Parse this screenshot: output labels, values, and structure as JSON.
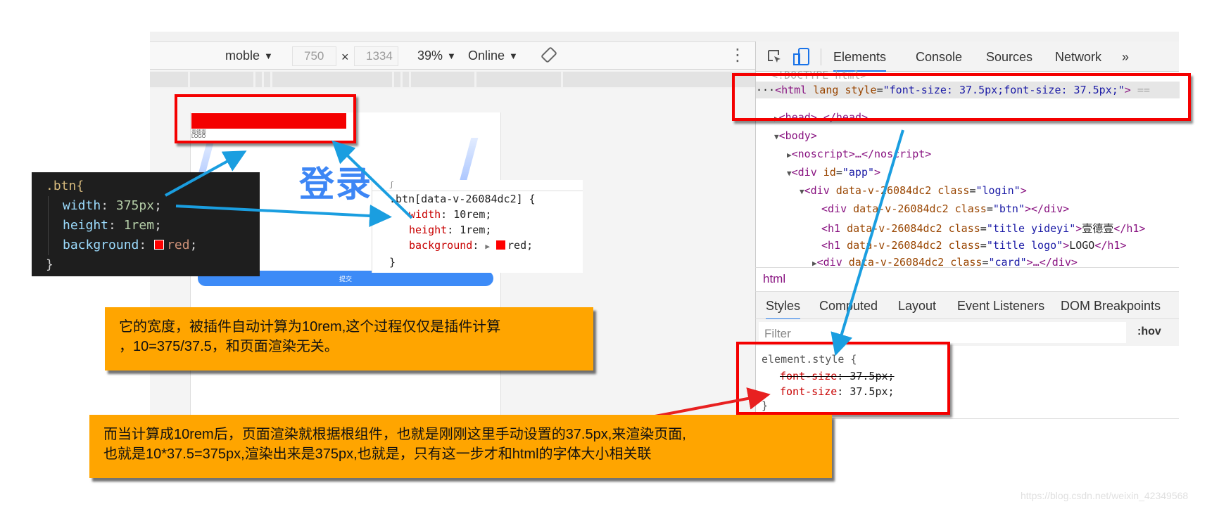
{
  "device_toolbar": {
    "device": "moble",
    "width": "750",
    "times": "×",
    "height": "1334",
    "zoom": "39%",
    "network": "Online",
    "dropdown_glyph": "▼",
    "more_glyph": "⋮"
  },
  "phone": {
    "yideyi": "壹德壹",
    "logo": "LOGO",
    "title": "登录",
    "submit": "提交"
  },
  "devtools": {
    "tabs": [
      "Elements",
      "Console",
      "Sources",
      "Network"
    ],
    "overflow": "»",
    "active_tab": "Elements",
    "dom": {
      "doctype": "<!DOCTYPE html>",
      "html_prefix": "···",
      "html_tag": "<html",
      "html_attr_lang": "lang",
      "html_attr_style": "style",
      "html_style_value": "\"font-size: 37.5px;font-size: 37.5px;\"",
      "html_close": ">",
      "html_suffix": " ==",
      "head": "<head>…</head>",
      "body": "<body>",
      "noscript": "<noscript>…</noscript>",
      "div_app_open": "<div",
      "div_app_attr": "id",
      "div_app_val": "\"app\"",
      "login_attr": "data-v-26084dc2",
      "login_class": "class",
      "login_val": "\"login\"",
      "btn_val": "\"btn\"",
      "yideyi_val": "\"title yideyi\"",
      "yideyi_text": "壹德壹",
      "logo_val": "\"title logo\"",
      "logo_text": "LOGO",
      "card_val": "\"card\""
    },
    "breadcrumb": "html",
    "subtabs": [
      "Styles",
      "Computed",
      "Layout",
      "Event Listeners",
      "DOM Breakpoints"
    ],
    "active_subtab": "Styles",
    "filter_placeholder": "Filter",
    "hov": ":hov",
    "styles": {
      "selector": "element.style {",
      "prop1": "font-size",
      "val1": ": 37.5px;",
      "prop2": "font-size",
      "val2": ": 37.5px;",
      "close": "}"
    }
  },
  "source_code": {
    "selector": ".btn{",
    "width_prop": "width",
    "width_val": "375px",
    "height_prop": "height",
    "height_val": "1rem",
    "bg_prop": "background",
    "bg_val": "red",
    "close": "}"
  },
  "compiled_code": {
    "selector": ".btn[data-v-26084dc2] {",
    "width_prop": "width",
    "width_val": ": 10rem;",
    "height_prop": "height",
    "height_val": ": 1rem;",
    "bg_prop": "background",
    "bg_val": "red;",
    "close": "}"
  },
  "notes": {
    "note1_line1": "它的宽度，被插件自动计算为10rem,这个过程仅仅是插件计算",
    "note1_line2": "，10=375/37.5，和页面渲染无关。",
    "note2_line1": "而当计算成10rem后，页面渲染就根据根组件，也就是刚刚这里手动设置的37.5px,来渲染页面,",
    "note2_line2": "也就是10*37.5=375px,渲染出来是375px,也就是，只有这一步才和html的字体大小相关联"
  },
  "colors": {
    "highlight_red": "#f40000",
    "arrow_blue": "#1a9ee0",
    "note_orange": "#ffa500",
    "accent_blue": "#1a73e8"
  },
  "watermark": "https://blog.csdn.net/weixin_42349568"
}
